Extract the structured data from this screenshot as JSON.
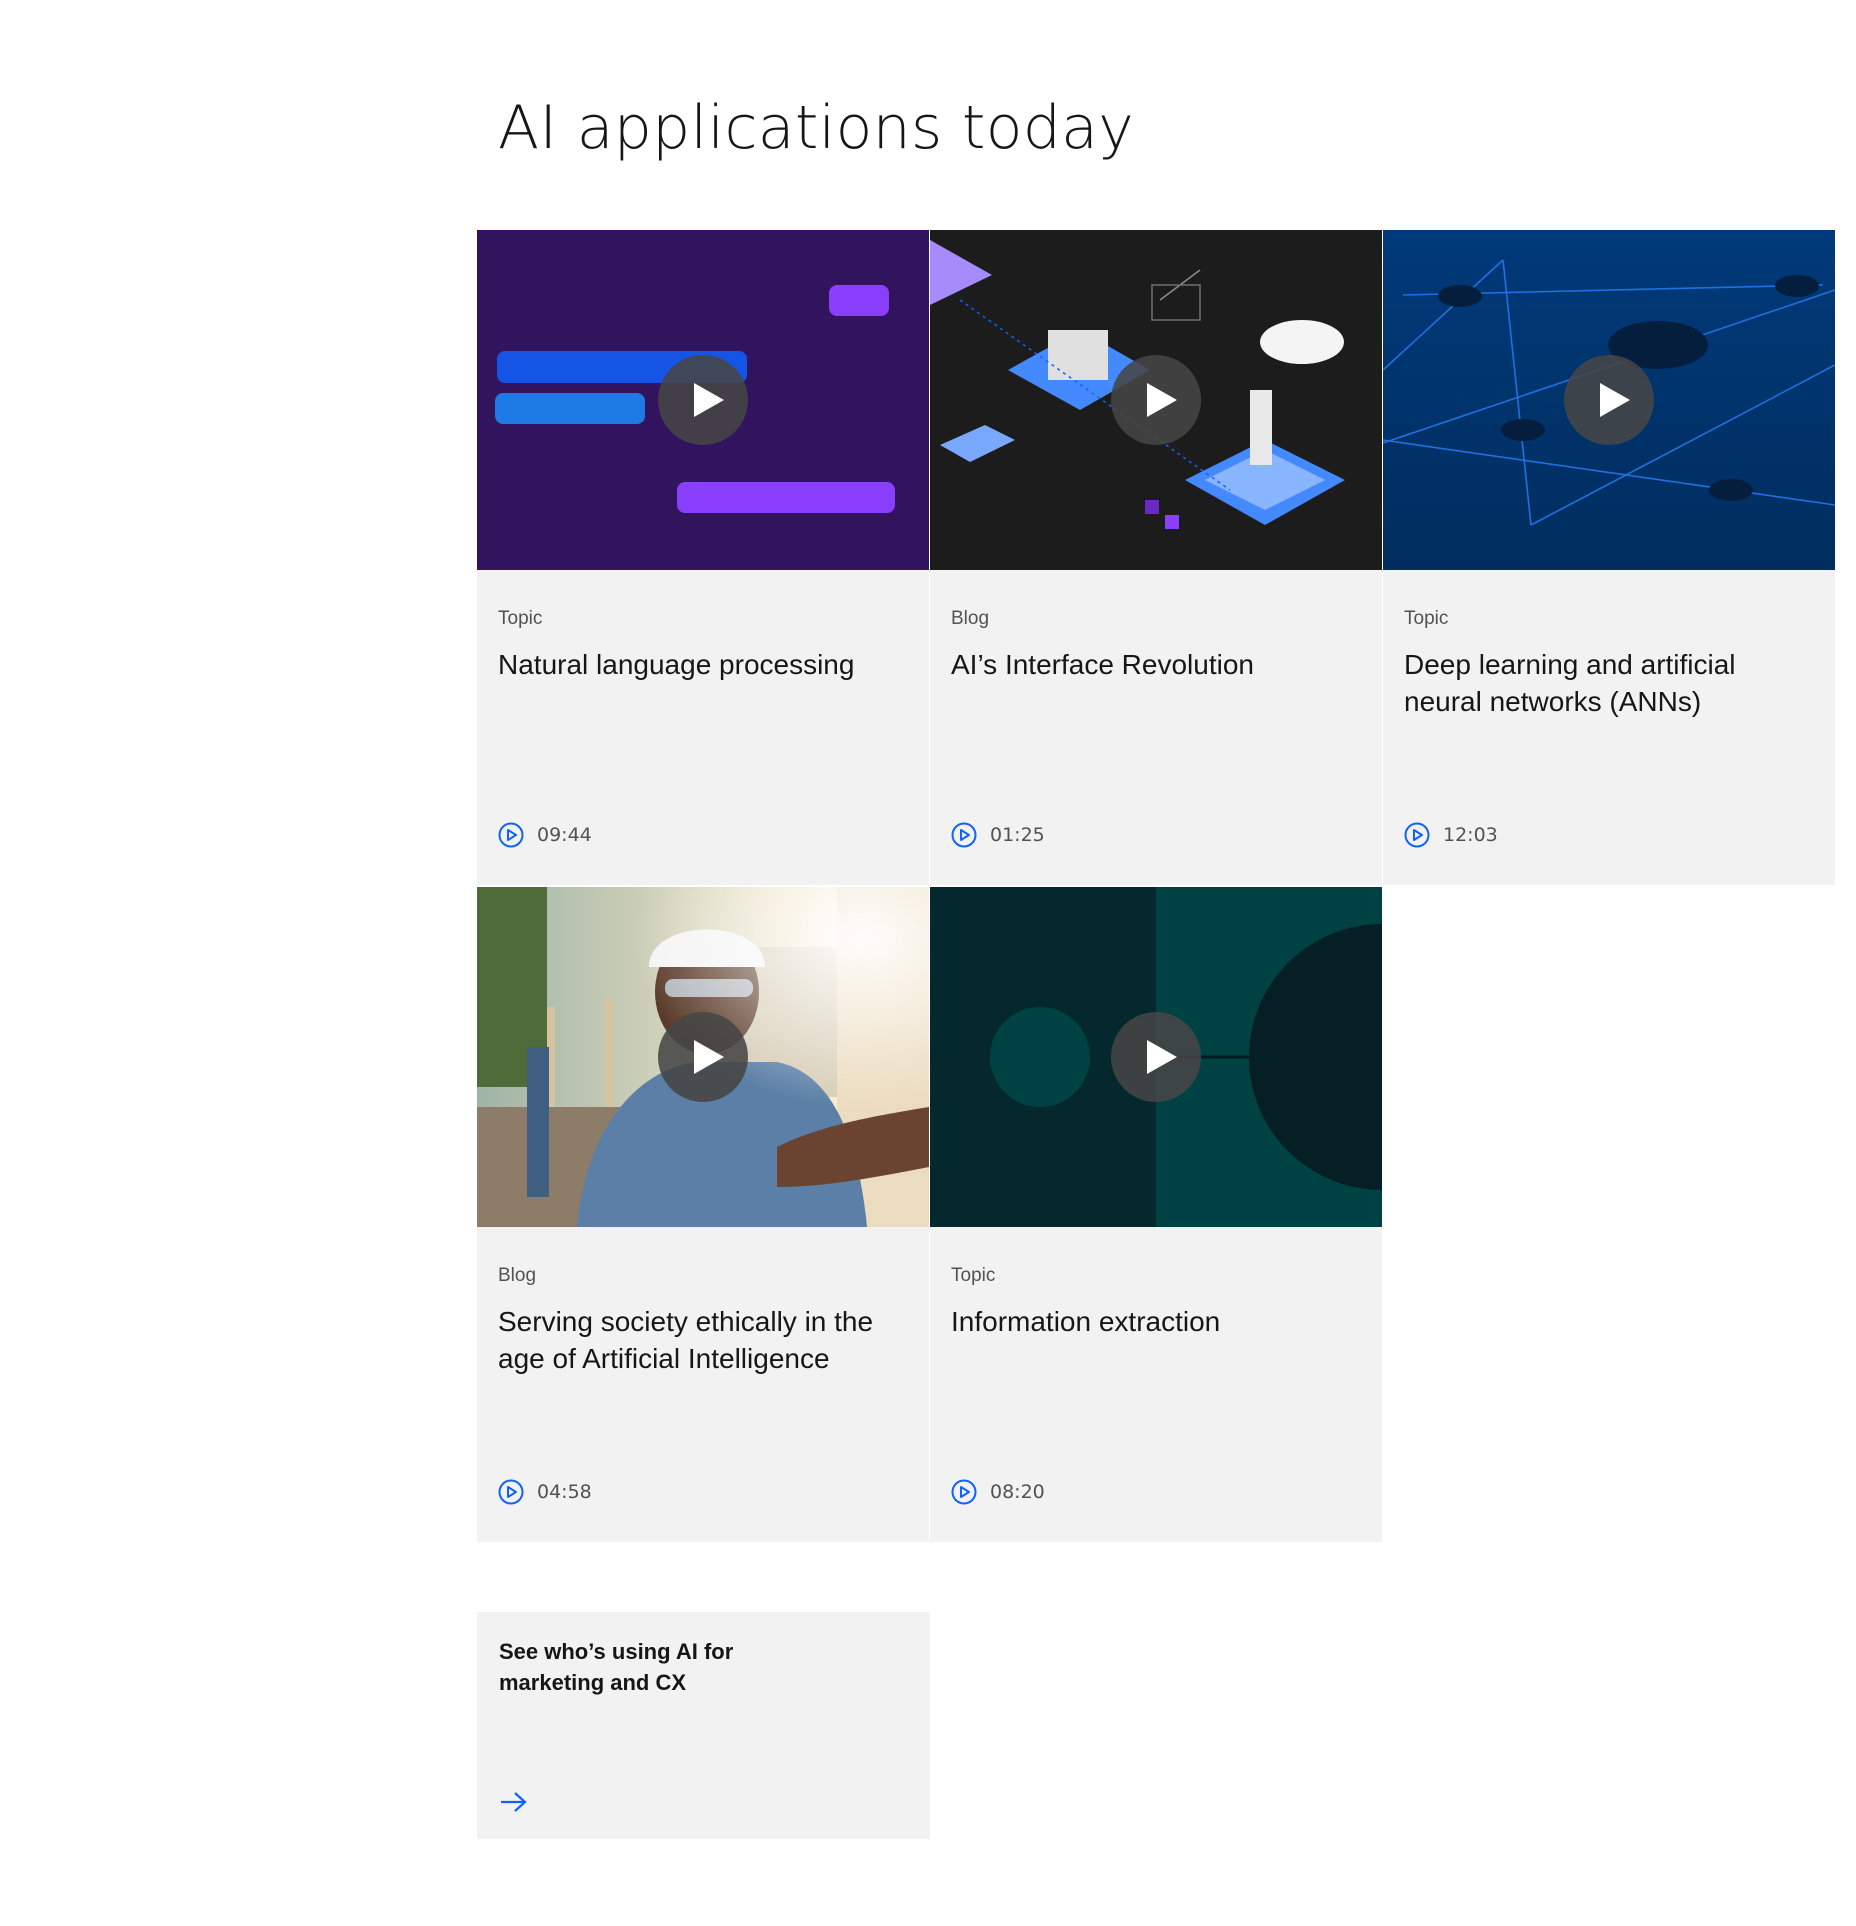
{
  "page": {
    "title": "AI applications today"
  },
  "cards": [
    {
      "eyebrow": "Topic",
      "title": "Natural language processing",
      "duration": "09:44",
      "thumbnail": "purple-chat-bubbles-illustration"
    },
    {
      "eyebrow": "Blog",
      "title": "AI’s Interface Revolution",
      "duration": "01:25",
      "thumbnail": "isometric-ai-interface-illustration"
    },
    {
      "eyebrow": "Topic",
      "title": "Deep learning and artificial neural networks (ANNs)",
      "duration": "12:03",
      "thumbnail": "blue-neural-network-illustration"
    },
    {
      "eyebrow": "Blog",
      "title": "Serving society ethically in the age of Artificial Intelligence",
      "duration": "04:58",
      "thumbnail": "construction-worker-photo"
    },
    {
      "eyebrow": "Topic",
      "title": "Information extraction",
      "duration": "08:20",
      "thumbnail": "teal-circles-illustration"
    }
  ],
  "cta": {
    "title": "See who’s using AI for marketing and CX",
    "icon": "arrow-right-icon"
  },
  "colors": {
    "accent": "#0f62fe",
    "card_bg": "#f2f2f2",
    "text": "#161616",
    "muted": "#525252"
  }
}
